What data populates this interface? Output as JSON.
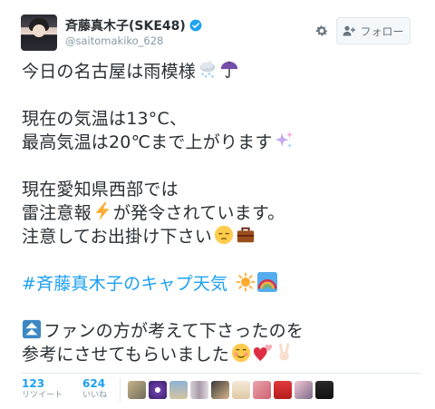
{
  "user": {
    "display_name": "斉藤真木子(SKE48)",
    "handle": "@saitomakiko_628"
  },
  "follow_button": {
    "label": "フォロー"
  },
  "tweet": {
    "line1": "今日の名古屋は雨模様",
    "line2": "現在の気温は13°C、",
    "line3": "最高気温は20℃まで上がります",
    "line4": "現在愛知県西部では",
    "line5a": "雷注意報",
    "line5b": "が発令されています。",
    "line6": "注意してお出掛け下さい",
    "hashtag": "#斉藤真木子のキャプ天気",
    "line8": "ファンの方が考えて下さったのを",
    "line9": "参考にさせてもらいました"
  },
  "stats": {
    "retweets": {
      "count": "123",
      "label": "リツイート"
    },
    "likes": {
      "count": "624",
      "label": "いいね"
    }
  },
  "icons": [
    "verified-badge-icon",
    "gear-icon",
    "add-user-icon",
    "snow-cloud-emoji",
    "umbrella-emoji",
    "sparkles-emoji",
    "lightning-emoji",
    "pensive-face-emoji",
    "briefcase-emoji",
    "sun-emoji",
    "rainbow-emoji",
    "up-button-emoji",
    "smiling-face-emoji",
    "two-hearts-emoji",
    "victory-hand-emoji"
  ],
  "colors": {
    "link": "#1da1f2",
    "text": "#292f33",
    "muted": "#8899a6"
  }
}
